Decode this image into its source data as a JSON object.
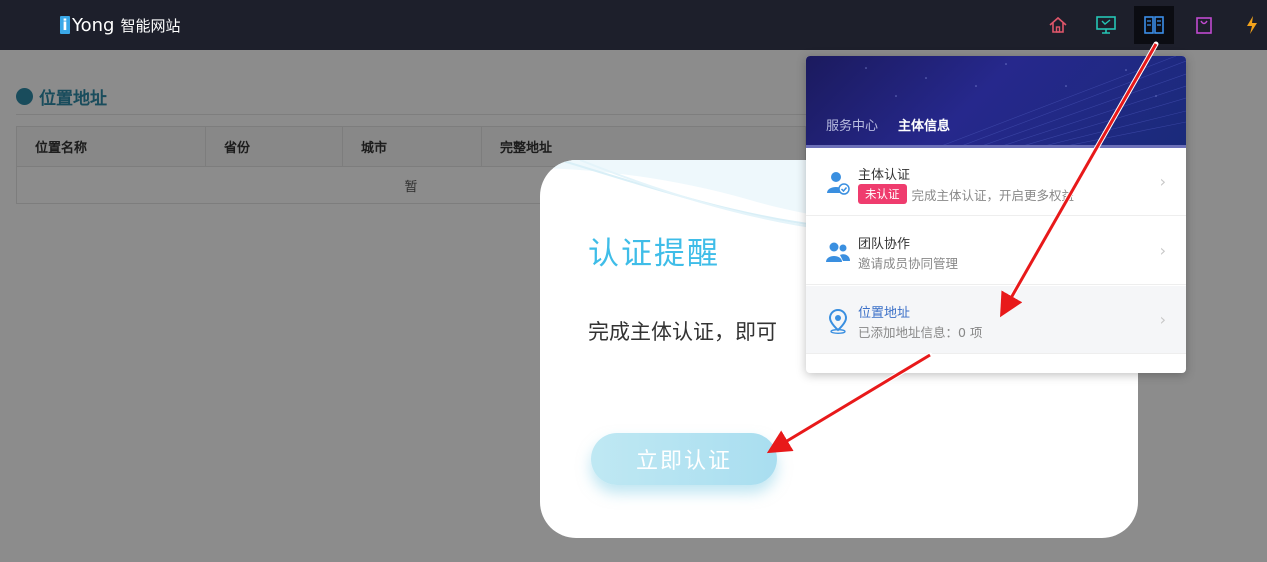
{
  "topbar": {
    "logo_letter": "i",
    "logo_text": "Yong",
    "logo_sub": "智能网站",
    "nav_icons": [
      "home-icon",
      "monitor-icon",
      "book-icon",
      "bag-icon",
      "lightning-icon"
    ]
  },
  "page": {
    "title": "位置地址",
    "columns": [
      "位置名称",
      "省份",
      "城市",
      "完整地址"
    ],
    "empty_text": "暂"
  },
  "modal": {
    "title": "认证提醒",
    "message": "完成主体认证，即可",
    "button_label": "立即认证"
  },
  "dropdown": {
    "tabs": [
      "服务中心",
      "主体信息"
    ],
    "active_tab": "主体信息",
    "items": [
      {
        "title": "主体认证",
        "badge": "未认证",
        "subtitle": "完成主体认证，开启更多权益",
        "icon": "user-verify-icon"
      },
      {
        "title": "团队协作",
        "subtitle": "邀请成员协同管理",
        "icon": "team-icon"
      },
      {
        "title": "位置地址",
        "subtitle": "已添加地址信息：0 项",
        "icon": "location-pin-icon"
      }
    ]
  },
  "colors": {
    "accent_teal": "#2e8ba8",
    "modal_title": "#3fbde8",
    "badge": "#ef3c6e",
    "annotation_arrow": "#e8191a"
  }
}
